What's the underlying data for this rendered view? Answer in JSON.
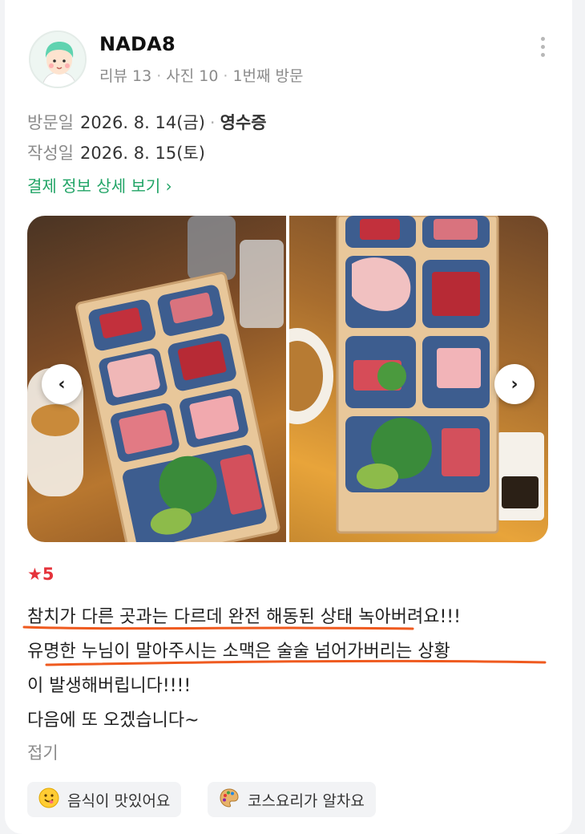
{
  "reviewer": {
    "name": "NADA8",
    "review_count": "리뷰 13",
    "photo_count": "사진 10",
    "visit_count": "1번째 방문"
  },
  "visit": {
    "visit_label": "방문일",
    "visit_date": "2026. 8. 14(금)",
    "receipt": "영수증",
    "written_label": "작성일",
    "written_date": "2026. 8. 15(토)",
    "detail_link": "결제 정보 상세 보기 ›"
  },
  "gallery": {
    "photos": [
      "tuna-platter-photo",
      "tuna-platter-closeup-photo"
    ]
  },
  "rating": {
    "value": "5"
  },
  "review": {
    "lines": [
      "참치가 다른 곳과는 다르데 완전 해동된 상태 녹아버려요!!!",
      "유명한 누님이 말아주시는 소맥은 술술 넘어가버리는 상황",
      "이 발생해버립니다!!!!",
      "다음에 또 오겠습니다~"
    ],
    "fold_label": "접기"
  },
  "tags": [
    {
      "icon": "tasty-face-icon",
      "label": "음식이 맛있어요"
    },
    {
      "icon": "palette-icon",
      "label": "코스요리가 알차요"
    }
  ],
  "colors": {
    "accent_green": "#21a466",
    "rating_red": "#e5333b",
    "underline_orange": "#ef5a1f"
  }
}
